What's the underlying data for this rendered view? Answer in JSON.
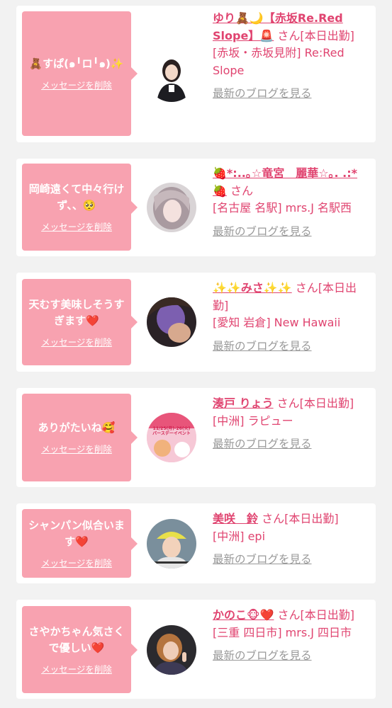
{
  "delete_label": "メッセージを削除",
  "blog_label": "最新のブログを見る",
  "colors": {
    "bubble": "#f8a2b0",
    "accent": "#e04470",
    "link_gray": "#999999"
  },
  "messages": [
    {
      "bubble_text": "🧸すぱ(๑╹ロ╹๑)✨",
      "name": "ゆり🧸🌙【赤坂Re.Red Slope】🚨",
      "suffix": "さん[本日出勤]",
      "shop": "[赤坂・赤坂見附] Re:Red Slope"
    },
    {
      "bubble_text": "岡崎遠くて中々行けず、、🥺",
      "name": "🍓*:..｡☆竜宮　麗華☆｡. .:*🍓",
      "suffix": "さん",
      "shop": "[名古屋 名駅] mrs.J 名駅西"
    },
    {
      "bubble_text": "天むす美味しそうすぎます❤️",
      "name": "✨✨みさ✨✨",
      "suffix": "さん[本日出勤]",
      "shop": "[愛知 岩倉] New Hawaii"
    },
    {
      "bubble_text": "ありがたいね🥰",
      "name": "湊戸 りょう",
      "suffix": "さん[本日出勤]",
      "shop": "[中洲] ラピュー",
      "avatar_text": "11/25(月)-26(火) バースデーイベント"
    },
    {
      "bubble_text": "シャンパン似合います❤️",
      "name": "美咲　鈴",
      "suffix": "さん[本日出勤]",
      "shop": "[中洲] epi"
    },
    {
      "bubble_text": "さやかちゃん気さくで優しい❤️",
      "name": "かのこ🐵❤️",
      "suffix": "さん[本日出勤]",
      "shop": "[三重 四日市] mrs.J 四日市"
    }
  ]
}
